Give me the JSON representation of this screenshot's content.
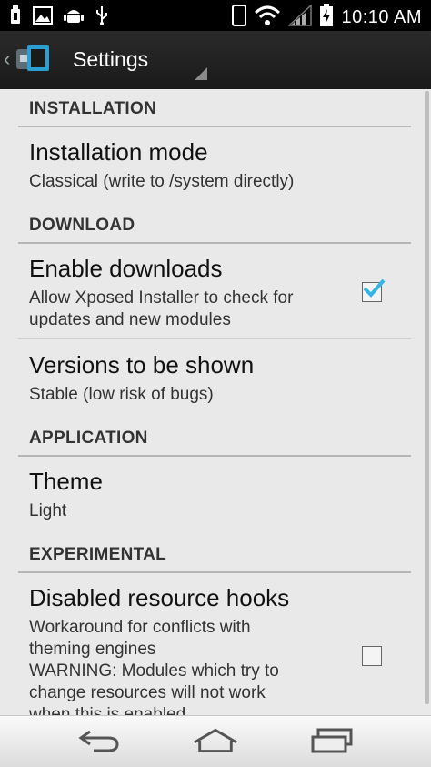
{
  "status_bar": {
    "time": "10:10 AM",
    "icons_left": [
      "usb-icon",
      "image-icon",
      "android-icon",
      "usb-symbol-icon"
    ],
    "icons_right": [
      "phone-icon",
      "wifi-icon",
      "signal-icon",
      "battery-charging-icon"
    ]
  },
  "action_bar": {
    "title": "Settings",
    "app_icon": "xposed-installer-icon",
    "back_icon": "chevron-left-icon"
  },
  "sections": {
    "installation": {
      "header": "INSTALLATION",
      "items": [
        {
          "title": "Installation mode",
          "summary": "Classical (write to /system directly)"
        }
      ]
    },
    "download": {
      "header": "DOWNLOAD",
      "items": [
        {
          "title": "Enable downloads",
          "summary": "Allow Xposed Installer to check for\nupdates and new modules",
          "checked": true
        },
        {
          "title": "Versions to be shown",
          "summary": "Stable (low risk of bugs)"
        }
      ]
    },
    "application": {
      "header": "APPLICATION",
      "items": [
        {
          "title": "Theme",
          "summary": "Light"
        }
      ]
    },
    "experimental": {
      "header": "EXPERIMENTAL",
      "items": [
        {
          "title": "Disabled resource hooks",
          "summary": "Workaround for conflicts with\ntheming engines\nWARNING: Modules which try to\nchange resources will not work\nwhen this is enabled",
          "checked": false
        }
      ]
    }
  },
  "nav_bar": {
    "buttons": [
      "back-icon",
      "home-icon",
      "recent-apps-icon"
    ]
  },
  "colors": {
    "background": "#e9e9e9",
    "action_bar": "#222222",
    "checkbox_accent": "#33b5e5",
    "header_text": "#333333"
  }
}
